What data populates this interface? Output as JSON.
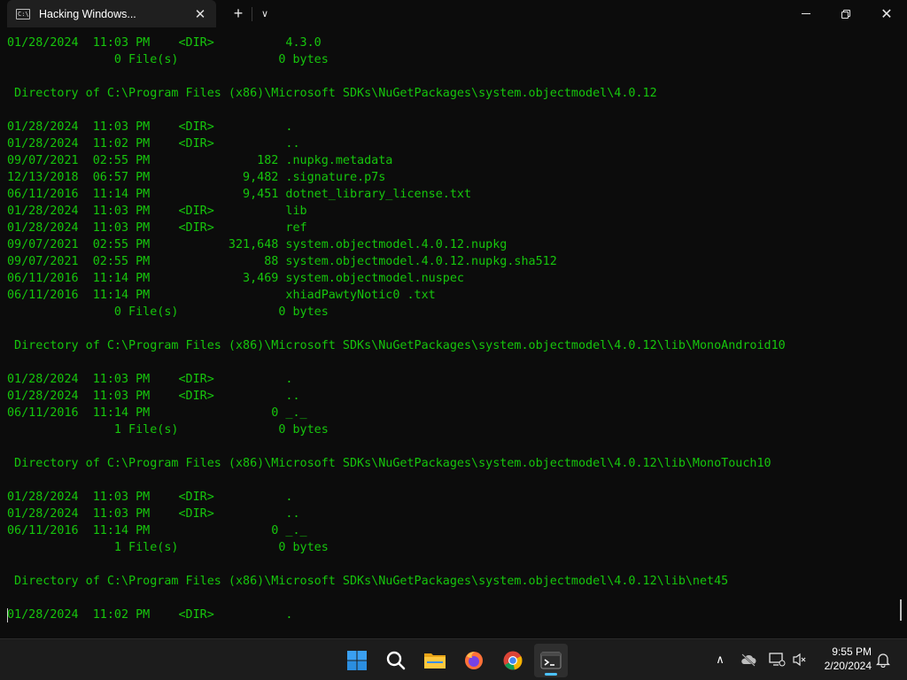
{
  "window": {
    "tab_title": "Hacking Windows...",
    "tab_icon_text": "C:\\",
    "close_tab_glyph": "✕",
    "new_tab_glyph": "+",
    "dropdown_glyph": "∨",
    "close_glyph": "✕"
  },
  "terminal": {
    "lines": [
      "01/28/2024  11:03 PM    <DIR>          4.3.0",
      "               0 File(s)              0 bytes",
      "",
      " Directory of C:\\Program Files (x86)\\Microsoft SDKs\\NuGetPackages\\system.objectmodel\\4.0.12",
      "",
      "01/28/2024  11:03 PM    <DIR>          .",
      "01/28/2024  11:02 PM    <DIR>          ..",
      "09/07/2021  02:55 PM               182 .nupkg.metadata",
      "12/13/2018  06:57 PM             9,482 .signature.p7s",
      "06/11/2016  11:14 PM             9,451 dotnet_library_license.txt",
      "01/28/2024  11:03 PM    <DIR>          lib",
      "01/28/2024  11:03 PM    <DIR>          ref",
      "09/07/2021  02:55 PM           321,648 system.objectmodel.4.0.12.nupkg",
      "09/07/2021  02:55 PM                88 system.objectmodel.4.0.12.nupkg.sha512",
      "06/11/2016  11:14 PM             3,469 system.objectmodel.nuspec",
      "06/11/2016  11:14 PM                   xhiadPawtyNotic0 .txt",
      "               0 File(s)              0 bytes",
      "",
      " Directory of C:\\Program Files (x86)\\Microsoft SDKs\\NuGetPackages\\system.objectmodel\\4.0.12\\lib\\MonoAndroid10",
      "",
      "01/28/2024  11:03 PM    <DIR>          .",
      "01/28/2024  11:03 PM    <DIR>          ..",
      "06/11/2016  11:14 PM                 0 _._",
      "               1 File(s)              0 bytes",
      "",
      " Directory of C:\\Program Files (x86)\\Microsoft SDKs\\NuGetPackages\\system.objectmodel\\4.0.12\\lib\\MonoTouch10",
      "",
      "01/28/2024  11:03 PM    <DIR>          .",
      "01/28/2024  11:03 PM    <DIR>          ..",
      "06/11/2016  11:14 PM                 0 _._",
      "               1 File(s)              0 bytes",
      "",
      " Directory of C:\\Program Files (x86)\\Microsoft SDKs\\NuGetPackages\\system.objectmodel\\4.0.12\\lib\\net45",
      "",
      "01/28/2024  11:02 PM    <DIR>          ."
    ]
  },
  "taskbar": {
    "apps": [
      {
        "name": "start-icon"
      },
      {
        "name": "search-icon"
      },
      {
        "name": "file-explorer-icon"
      },
      {
        "name": "firefox-icon"
      },
      {
        "name": "chrome-icon"
      },
      {
        "name": "terminal-icon",
        "active": true
      }
    ],
    "tray_chevron": "∧",
    "clock_time": "9:55 PM",
    "clock_date": "2/20/2024"
  },
  "colors": {
    "terminal_bg": "#0c0c0c",
    "terminal_text": "#16c60c",
    "taskbar_bg": "#1c1c1c",
    "accent": "#4cc2ff"
  }
}
